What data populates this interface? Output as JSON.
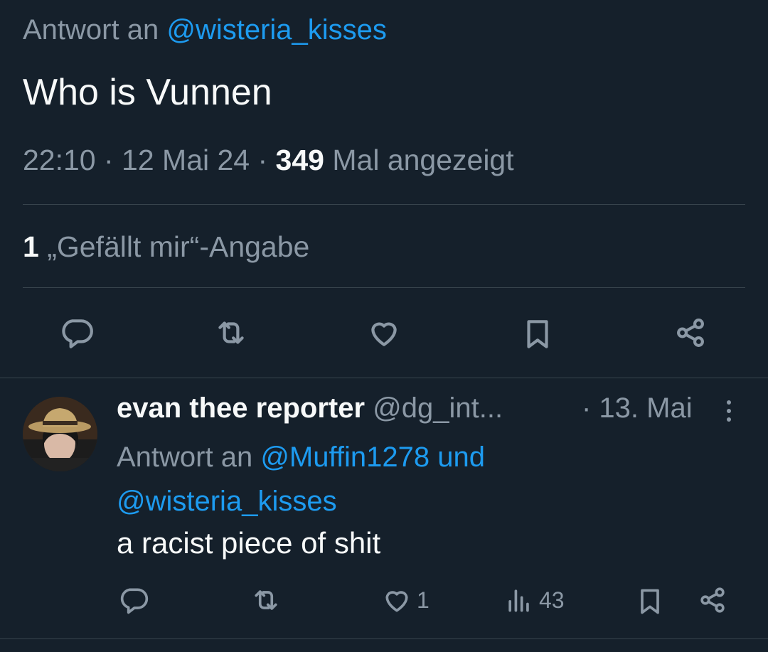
{
  "main_tweet": {
    "reply_prefix": "Antwort an",
    "reply_handle": "@wisteria_kisses",
    "text": "Who is Vunnen",
    "time": "22:10",
    "sep1": " · ",
    "date": "12 Mai 24",
    "sep2": " · ",
    "views_count": "349",
    "views_label": " Mal angezeigt",
    "likes_count": "1",
    "likes_label": " „Gefällt mir“-Angabe",
    "actions": [
      "reply-icon",
      "retweet-icon",
      "like-icon",
      "bookmark-icon",
      "share-icon"
    ]
  },
  "reply_tweet": {
    "display_name": "evan thee reporter",
    "handle": " @dg_int...",
    "date": "· 13. Mai",
    "reply_prefix": "Antwort an ",
    "reply_handle_1": "@Muffin1278",
    "reply_and": " und",
    "reply_handle_2": "@wisteria_kisses",
    "text": "a racist piece of shit",
    "like_count": "1",
    "view_count": "43"
  },
  "colors": {
    "background": "#15202b",
    "text": "#f7f9f9",
    "muted": "#8b98a5",
    "link": "#1d9bf0",
    "divider": "#38444d"
  }
}
